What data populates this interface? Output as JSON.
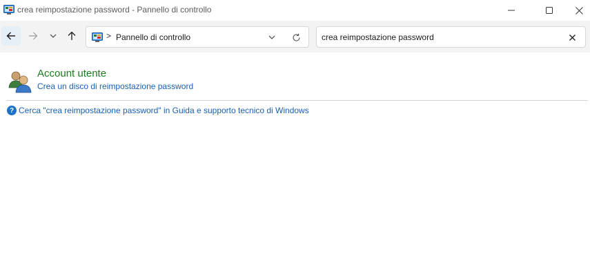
{
  "window": {
    "title": "crea reimpostazione password - Pannello di controllo",
    "app_icon": "control-panel-icon",
    "controls": [
      "minimize-icon",
      "maximize-icon",
      "close-icon"
    ]
  },
  "navigation": {
    "back_icon": "arrow-left-icon",
    "forward_icon": "arrow-right-icon",
    "recent_icon": "chevron-down-icon",
    "up_icon": "arrow-up-icon",
    "address": {
      "icon": "control-panel-icon",
      "separator": ">",
      "path": "Pannello di controllo",
      "dropdown_icon": "chevron-down-icon",
      "refresh_icon": "refresh-icon"
    },
    "search": {
      "value": "crea reimpostazione password",
      "clear_icon": "close-icon"
    }
  },
  "results": [
    {
      "icon": "user-accounts-icon",
      "title": "Account utente",
      "link": "Crea un disco di reimpostazione password"
    }
  ],
  "help": {
    "icon": "help-icon",
    "text": "Cerca \"crea reimpostazione password\" in Guida e supporto tecnico di Windows"
  },
  "colors": {
    "category_title": "#1e7a1e",
    "link": "#1a5fb4",
    "nav_background": "#f3f3f3"
  }
}
